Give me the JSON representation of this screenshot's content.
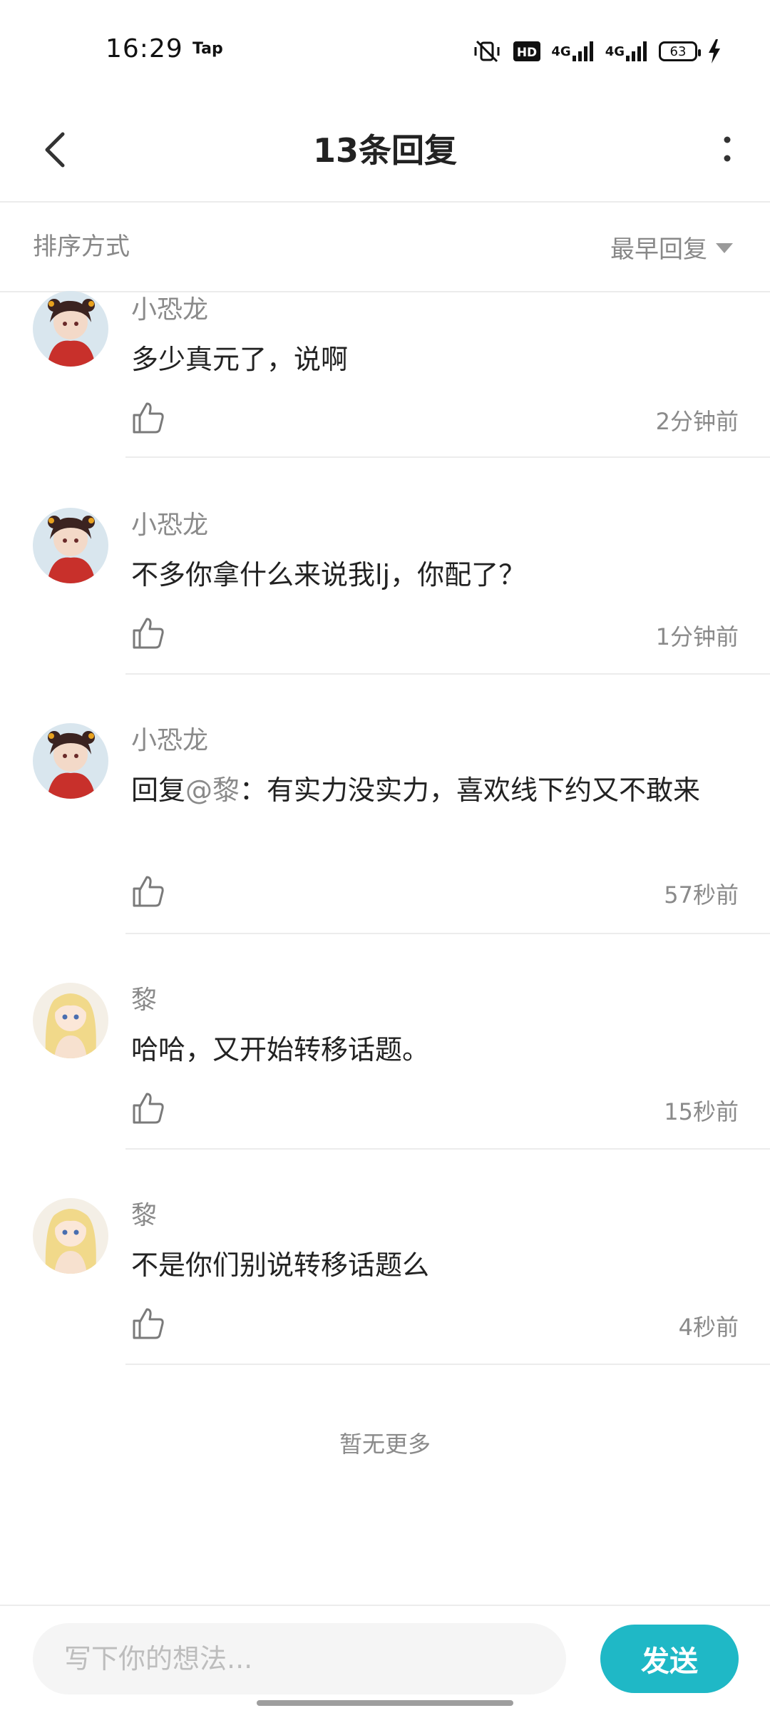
{
  "status_bar": {
    "time": "16:29",
    "carrier_badge": "Tap",
    "hd_label": "HD",
    "net1": "4G",
    "net2": "4G",
    "battery": "63",
    "icons": [
      "mute-vibrate-icon",
      "hd-icon",
      "signal-icon",
      "signal-icon",
      "battery-icon",
      "charging-icon"
    ]
  },
  "header": {
    "title": "13条回复",
    "back_icon": "chevron-left-icon",
    "more_icon": "more-vertical-icon"
  },
  "sort": {
    "label": "排序方式",
    "selected": "最早回复"
  },
  "comments": [
    {
      "user": "小恐龙",
      "avatar": "red-girl-avatar",
      "text": "多少真元了，说啊",
      "time": "2分钟前"
    },
    {
      "user": "小恐龙",
      "avatar": "red-girl-avatar",
      "text": "不多你拿什么来说我lj，你配了？",
      "time": "1分钟前"
    },
    {
      "user": "小恐龙",
      "avatar": "red-girl-avatar",
      "reply_prefix": "回复",
      "mention": "@黎",
      "text": "：有实力没实力，喜欢线下约又不敢来",
      "time": "57秒前"
    },
    {
      "user": "黎",
      "avatar": "blonde-girl-avatar",
      "text": "哈哈，又开始转移话题。",
      "time": "15秒前"
    },
    {
      "user": "黎",
      "avatar": "blonde-girl-avatar",
      "text": "不是你们别说转移话题么",
      "time": "4秒前"
    }
  ],
  "footer_note": "暂无更多",
  "composer": {
    "placeholder": "写下你的想法...",
    "send_label": "发送"
  },
  "colors": {
    "accent": "#1fb8c6",
    "muted_text": "#8a8a8a",
    "divider": "#ececec"
  }
}
